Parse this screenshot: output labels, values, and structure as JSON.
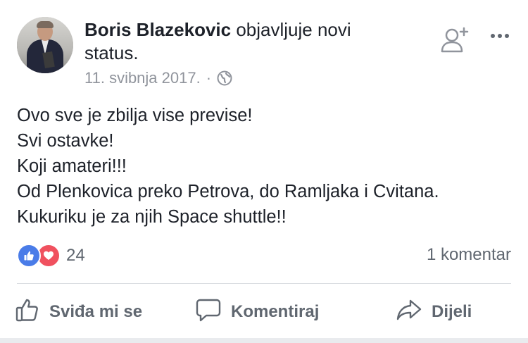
{
  "post": {
    "author": "Boris Blazekovic",
    "action_text": " objavljuje novi status.",
    "date": "11. svibnja 2017.",
    "separator": "·",
    "privacy_icon": "globe-icon",
    "header_icons": [
      "add-friend-icon",
      "more-icon"
    ],
    "body_lines": [
      "Ovo sve je zbilja vise previse!",
      "Svi ostavke!",
      "Koji amateri!!!",
      "Od Plenkovica preko Petrova, do Ramljaka i Cvitana.",
      "Kukuriku je za njih Space shuttle!!"
    ]
  },
  "reactions": {
    "types": [
      "like",
      "love"
    ],
    "count": "24",
    "like_color": "#4a7ce8",
    "love_color": "#f0515f"
  },
  "comments": {
    "count_text": "1 komentar"
  },
  "actions": {
    "like_label": "Sviđa mi se",
    "comment_label": "Komentiraj",
    "share_label": "Dijeli"
  },
  "colors": {
    "text": "#1d2129",
    "muted": "#606770",
    "meta": "#90949c",
    "divider": "#dadde1"
  }
}
